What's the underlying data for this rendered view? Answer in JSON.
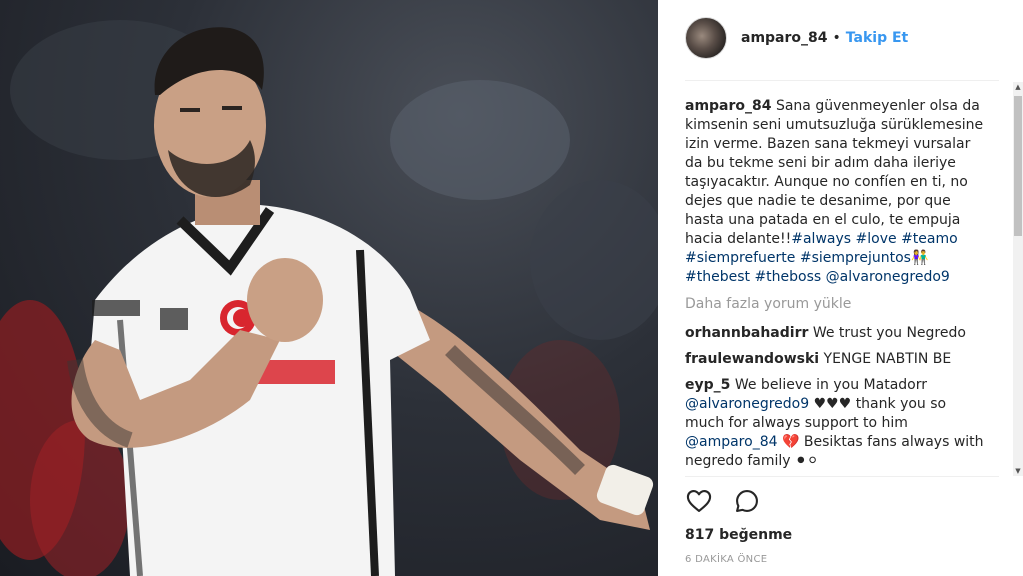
{
  "post": {
    "username": "amparo_84",
    "header_separator": "•",
    "follow_label": "Takip Et",
    "photo_icon": "photo-of-footballer",
    "avatar_icon": "user-avatar"
  },
  "caption": {
    "username": "amparo_84",
    "text_before_tags": " Sana güvenmeyenler olsa da kimsenin seni umutsuzluğa sürüklemesine izin verme. Bazen sana tekmeyi vursalar da bu tekme seni bir adım daha ileriye taşıyacaktır. Aunque no confíen en ti, no dejes que nadie te desanime, por que hasta una patada en el culo, te empuja hacia delante!!",
    "tags": [
      "#always",
      "#love",
      "#teamo",
      "#siemprefuerte",
      "#siemprejuntos",
      "#thebest",
      "#theboss",
      "@alvaronegredo9"
    ],
    "emoji_couple": "👫"
  },
  "load_more_label": "Daha fazla yorum yükle",
  "comments": [
    {
      "username": "orhannbahadirr",
      "text": " We trust you Negredo"
    },
    {
      "username": "fraulewandowski",
      "text": " YENGE NABTIN BE"
    },
    {
      "username": "eyp_5",
      "text_1": " We believe in you Matadorr ",
      "mention_1": "@alvaronegredo9",
      "text_2": " ♥♥♥ thank you so much for always support to him ",
      "mention_2": "@amparo_84",
      "text_3": " 💔 Besiktas fans always with negredo family ",
      "circles": "⚫⚪"
    }
  ],
  "actions": {
    "like_icon": "heart-icon",
    "comment_icon": "comment-icon"
  },
  "likes_label": "817 beğenme",
  "timestamp": "6 DAKİKA ÖNCE",
  "colors": {
    "link": "#003569",
    "follow": "#3897f0",
    "text": "#262626",
    "muted": "#999999",
    "divider": "#efefef"
  }
}
